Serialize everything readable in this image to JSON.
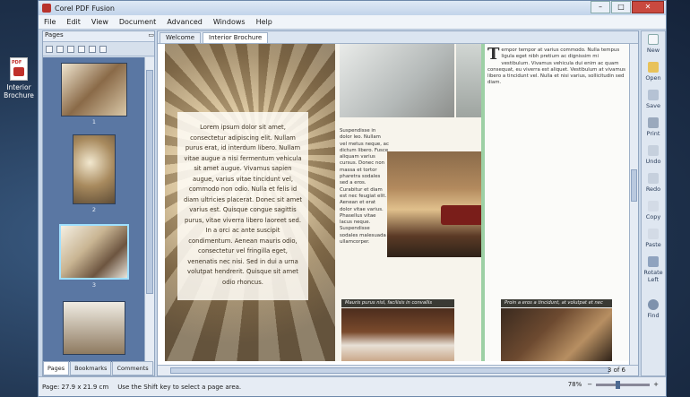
{
  "window": {
    "title": "Corel PDF Fusion",
    "minimize": "–",
    "maximize": "□",
    "close": "✕"
  },
  "desktop": {
    "icon_label": "Interior Brochure",
    "pdf_tag": "PDF"
  },
  "menu": [
    "File",
    "Edit",
    "View",
    "Document",
    "Advanced",
    "Windows",
    "Help"
  ],
  "pages_panel": {
    "title": "Pages",
    "page_numbers": [
      "1",
      "2",
      "3"
    ],
    "tabs": [
      "Pages",
      "Bookmarks",
      "Comments"
    ]
  },
  "doc_tabs": {
    "welcome": "Welcome",
    "current": "Interior Brochure"
  },
  "page_content": {
    "left_text": "Lorem ipsum dolor sit amet, consectetur adipiscing elit. Nullam purus erat, id interdum libero. Nullam vitae augue a nisi fermentum vehicula sit amet augue. Vivamus sapien augue, varius vitae tincidunt vel, commodo non odio. Nulla et felis id diam ultricies placerat. Donec sit amet varius est. Quisque congue sagittis purus, vitae viverra libero laoreet sed. In a orci ac ante suscipit condimentum. Aenean mauris odio, consectetur vel fringilla eget, venenatis nec nisi. Sed in dui a urna volutpat hendrerit. Quisque sit amet odio rhoncus.",
    "col2_text": "Suspendisse in dolor leo. Nullam vel metus neque, ac dictum libero. Fusce aliquam varius cursus. Donec non massa et tortor pharetra sodales sed a eros. Curabitur et diam est nec feugiat elit. Aenean et erat dolor vitae varius. Phasellus vitae lacus neque. Suspendisse sodales malesuada ullamcorper.",
    "col4_dropcap": "T",
    "col4_text": "empor tempor at varius commodo. Nulla tempus ligula eget nibh pretium ac dignissim mi vestibulum. Vivamus vehicula dui enim ac quam consequat, eu viverra est aliquet. Vestibulum at vivamus libero a tincidunt vel. Nulla et nisi varius, sollicitudin sed diam.",
    "caption1": "Mauris purus nisl, facilisis in convallis",
    "caption2": "Proin a eros a tincidunt, at volutpat et nec"
  },
  "page_indicator": "3 of 6",
  "toolbar_right": [
    "New",
    "Open",
    "Save",
    "Print",
    "Undo",
    "Redo",
    "Copy",
    "Paste",
    "Rotate Left",
    "Find"
  ],
  "status": {
    "page_size": "Page: 27.9 x 21.9 cm",
    "hint": "Use the Shift key to select a page area.",
    "zoom": "78%",
    "zoom_minus": "−",
    "zoom_plus": "+"
  }
}
